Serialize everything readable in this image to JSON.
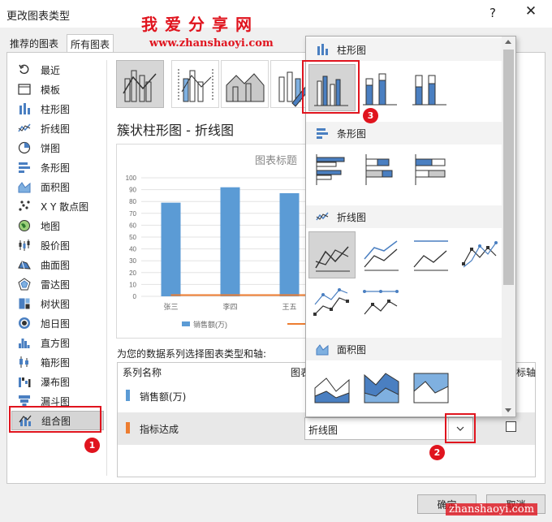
{
  "window": {
    "title": "更改图表类型",
    "help": "?",
    "close": "✕",
    "watermark_top": "我爱分享网",
    "watermark_url": "www.zhanshaoyi.com",
    "watermark_bottom": "zhanshaoyi.com"
  },
  "tabs": [
    "推荐的图表",
    "所有图表"
  ],
  "sidebar": [
    {
      "label": "最近",
      "icon": "recent-icon"
    },
    {
      "label": "模板",
      "icon": "template-icon"
    },
    {
      "label": "柱形图",
      "icon": "column-chart-icon"
    },
    {
      "label": "折线图",
      "icon": "line-chart-icon"
    },
    {
      "label": "饼图",
      "icon": "pie-chart-icon"
    },
    {
      "label": "条形图",
      "icon": "bar-chart-icon"
    },
    {
      "label": "面积图",
      "icon": "area-chart-icon"
    },
    {
      "label": "X Y 散点图",
      "icon": "scatter-chart-icon"
    },
    {
      "label": "地图",
      "icon": "map-chart-icon"
    },
    {
      "label": "股价图",
      "icon": "stock-chart-icon"
    },
    {
      "label": "曲面图",
      "icon": "surface-chart-icon"
    },
    {
      "label": "雷达图",
      "icon": "radar-chart-icon"
    },
    {
      "label": "树状图",
      "icon": "treemap-chart-icon"
    },
    {
      "label": "旭日图",
      "icon": "sunburst-chart-icon"
    },
    {
      "label": "直方图",
      "icon": "histogram-chart-icon"
    },
    {
      "label": "箱形图",
      "icon": "boxwhisker-chart-icon"
    },
    {
      "label": "瀑布图",
      "icon": "waterfall-chart-icon"
    },
    {
      "label": "漏斗图",
      "icon": "funnel-chart-icon"
    },
    {
      "label": "组合图",
      "icon": "combo-chart-icon"
    }
  ],
  "main": {
    "subtype_title": "簇状柱形图 - 折线图",
    "assign_label": "为您的数据系列选择图表类型和轴:",
    "table_headers": {
      "series": "系列名称",
      "type": "图表",
      "axis": "标轴"
    },
    "rows": [
      {
        "name": "销售额(万)",
        "color": "#5b9bd5"
      },
      {
        "name": "指标达成",
        "color": "#ed7d31",
        "chart_type": "折线图"
      }
    ]
  },
  "chart_data": {
    "type": "bar",
    "title": "图表标题",
    "categories": [
      "张三",
      "李四",
      "王五"
    ],
    "series": [
      {
        "name": "销售额(万)",
        "values": [
          79,
          92,
          87
        ],
        "color": "#5b9bd5"
      },
      {
        "values": [
          1,
          1,
          1
        ],
        "color": "#ed7d31"
      }
    ],
    "ylim": [
      0,
      100
    ],
    "yticks": [
      0,
      10,
      20,
      30,
      40,
      50,
      60,
      70,
      80,
      90,
      100
    ],
    "grid": true,
    "legend": "bottom"
  },
  "dropdown": {
    "sections": [
      {
        "label": "柱形图",
        "icon": "column-chart-icon"
      },
      {
        "label": "条形图",
        "icon": "bar-chart-icon"
      },
      {
        "label": "折线图",
        "icon": "line-chart-icon"
      },
      {
        "label": "面积图",
        "icon": "area-chart-icon"
      }
    ]
  },
  "annotations": [
    "1",
    "2",
    "3"
  ],
  "buttons": {
    "ok": "确定",
    "cancel": "取消"
  }
}
